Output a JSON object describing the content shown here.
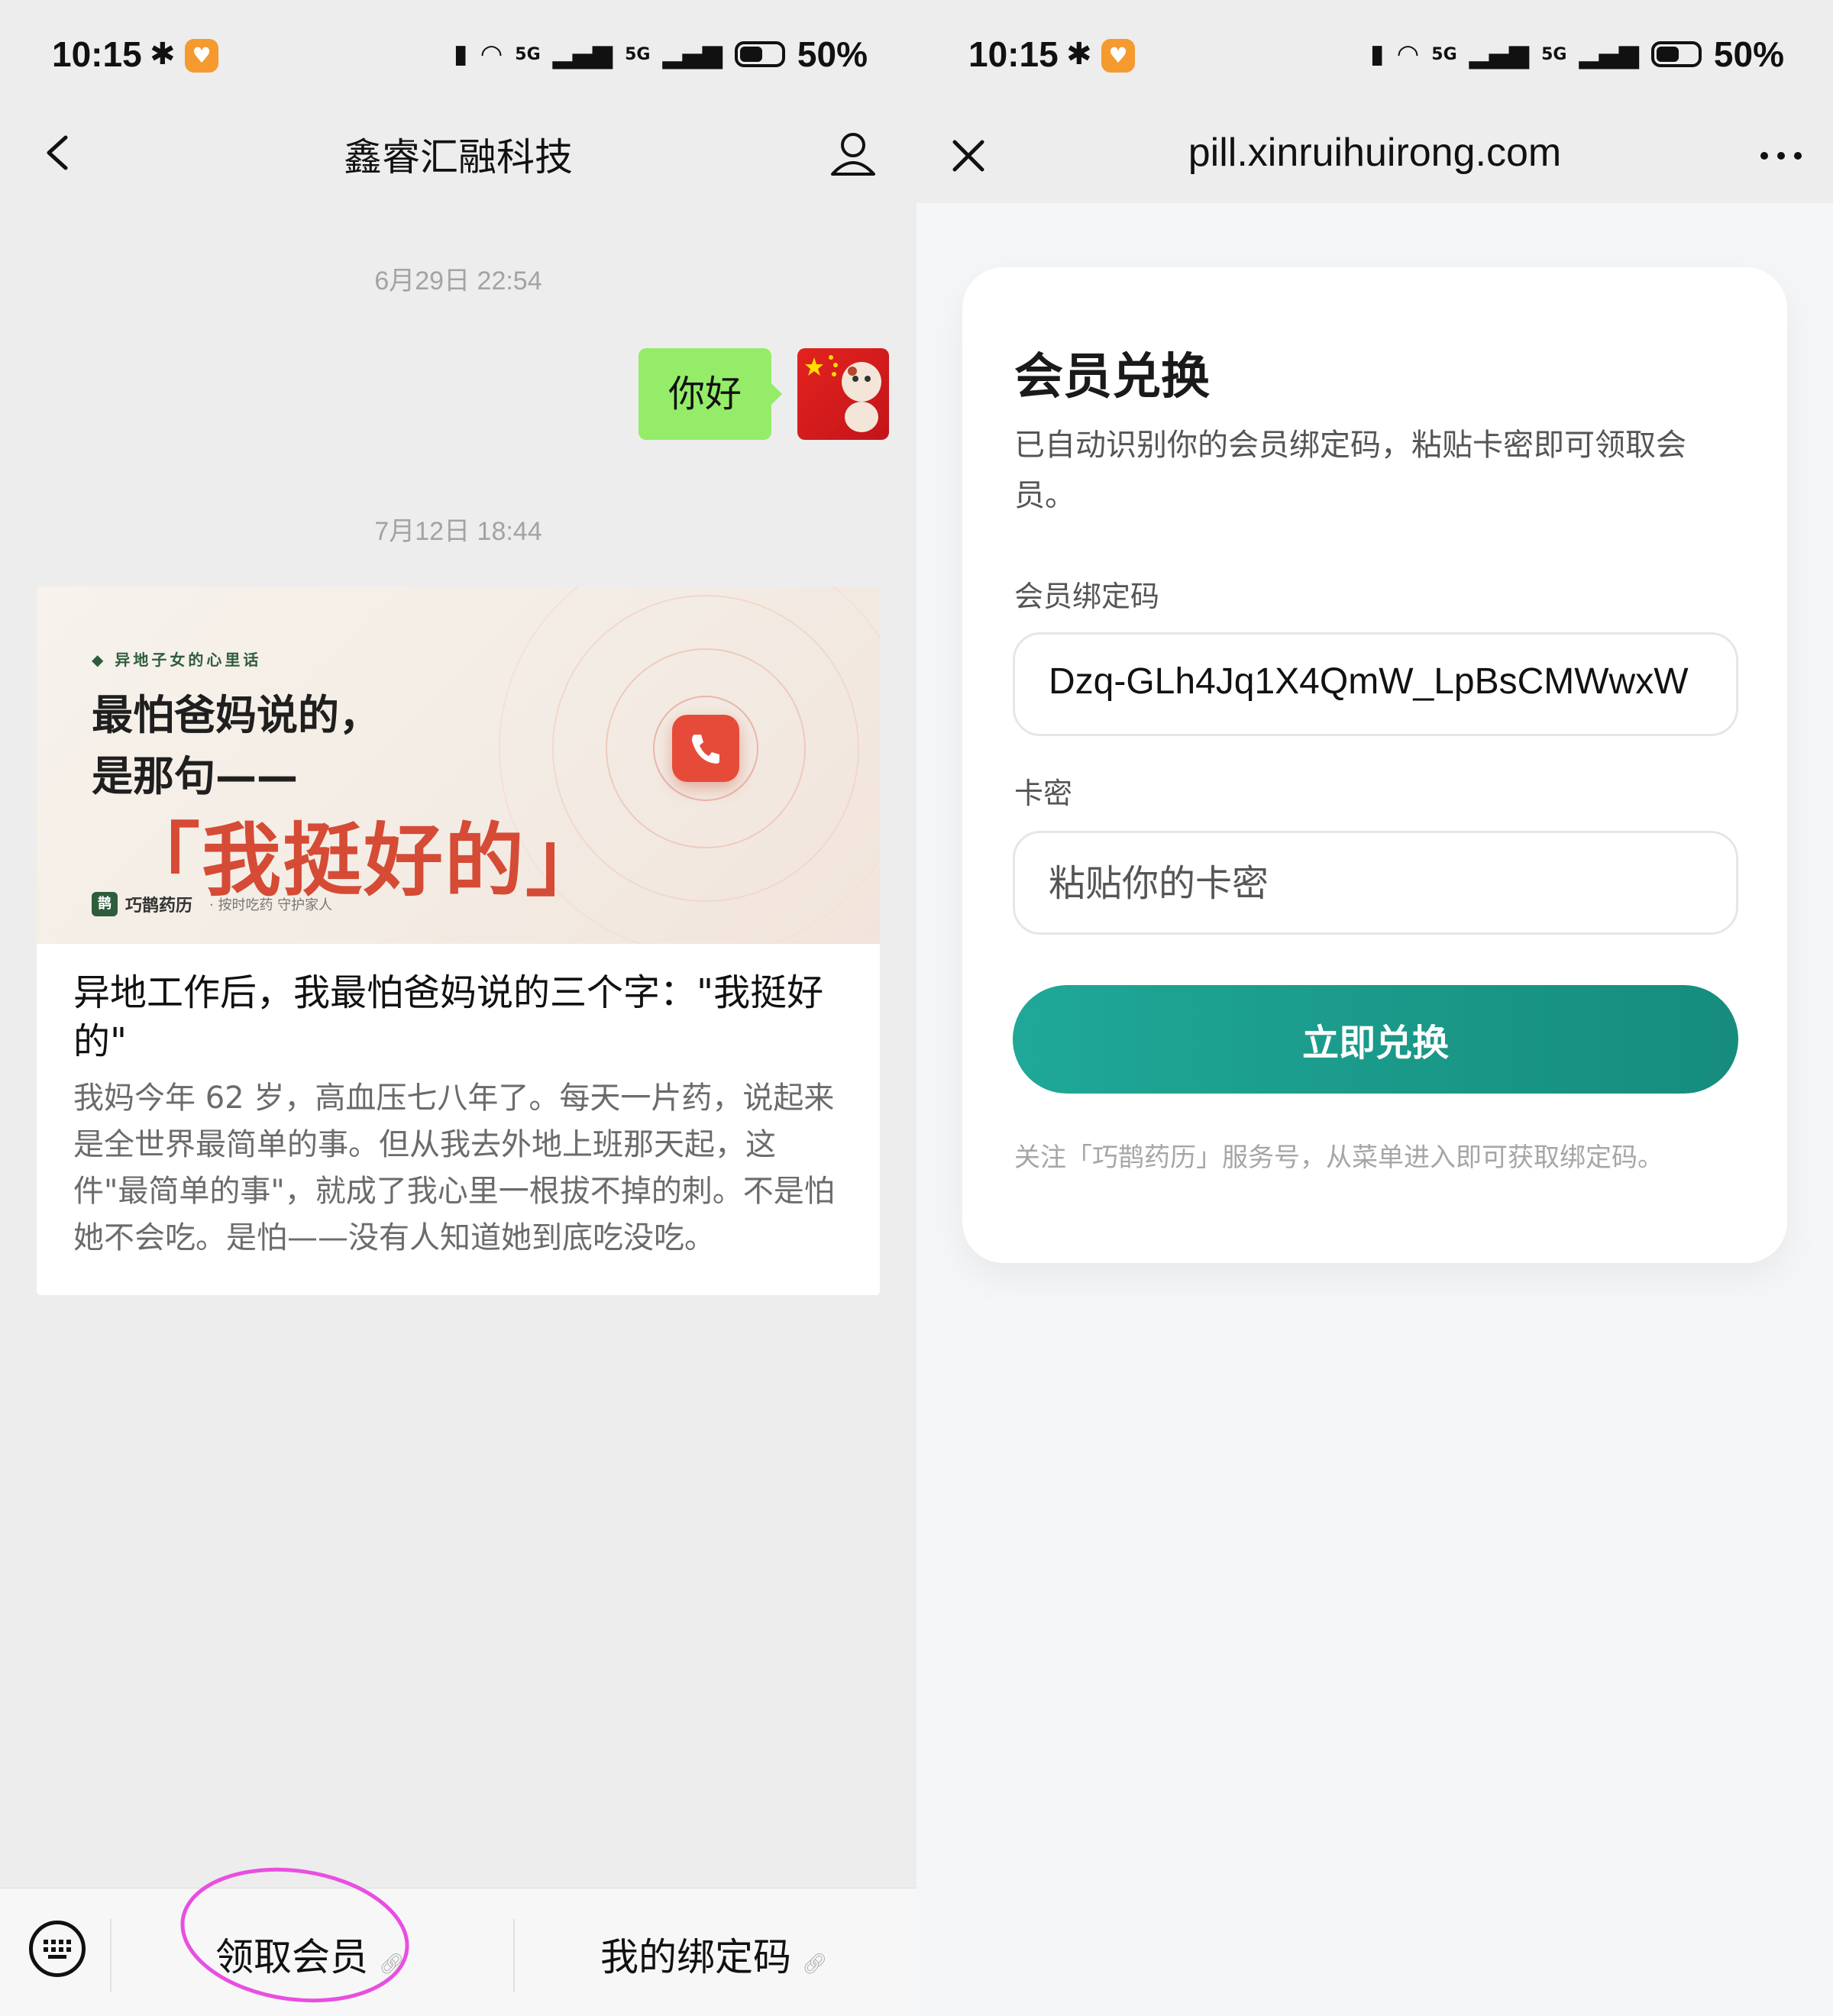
{
  "status_bar": {
    "time": "10:15",
    "net1": "5G",
    "net2": "5G",
    "battery_pct": "50%",
    "battery_level": 0.5
  },
  "chat": {
    "title": "鑫睿汇融科技",
    "messages": [
      {
        "timestamp": "6月29日 22:54",
        "text": "你好"
      },
      {
        "timestamp": "7月12日 18:44"
      }
    ],
    "article": {
      "cover_tag": "◆ 异地子女的心里话",
      "cover_line1": "最怕爸妈说的，",
      "cover_line2": "是那句——",
      "cover_quote": "「我挺好的」",
      "cover_brand_badge": "鹊",
      "cover_brand": "巧鹊药历",
      "cover_slogan": "· 按时吃药 守护家人",
      "title": "异地工作后，我最怕爸妈说的三个字：\"我挺好的\"",
      "desc": "我妈今年 62 岁，高血压七八年了。每天一片药，说起来是全世界最简单的事。但从我去外地上班那天起，这件\"最简单的事\"，就成了我心里一根拔不掉的刺。不是怕她不会吃。是怕——没有人知道她到底吃没吃。"
    },
    "menu": [
      {
        "label": "领取会员",
        "icon": "link-icon"
      },
      {
        "label": "我的绑定码",
        "icon": "link-icon"
      }
    ],
    "annotation_color": "#e84fe0"
  },
  "web": {
    "url": "pill.xinruihuirong.com",
    "card": {
      "title": "会员兑换",
      "desc": "已自动识别你的会员绑定码，粘贴卡密即可领取会员。",
      "bind_code_label": "会员绑定码",
      "bind_code_value": "Dzq-GLh4Jq1X4QmW_LpBsCMWwxW",
      "card_pwd_label": "卡密",
      "card_pwd_placeholder": "粘贴你的卡密",
      "submit_label": "立即兑换",
      "hint": "关注「巧鹊药历」服务号，从菜单进入即可获取绑定码。"
    },
    "accent_color": "#1a9a8a"
  }
}
